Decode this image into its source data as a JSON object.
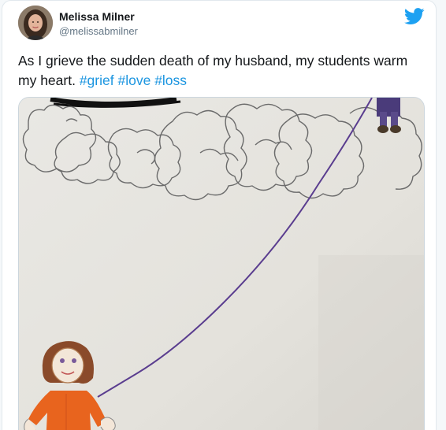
{
  "tweet": {
    "author_name": "Melissa Milner",
    "author_handle": "@melissabmilner",
    "text_before": "As I grieve the sudden death of my husband, my students warm my heart. ",
    "hashtags": [
      "#grief",
      "#love",
      "#loss"
    ]
  },
  "colors": {
    "link": "#1b95e0",
    "twitter_brand": "#1da1f2",
    "text": "#14171a",
    "secondary_text": "#657786"
  },
  "icons": {
    "brand": "twitter-bird-icon"
  },
  "media": {
    "kind": "photo of a child's crayon drawing"
  }
}
